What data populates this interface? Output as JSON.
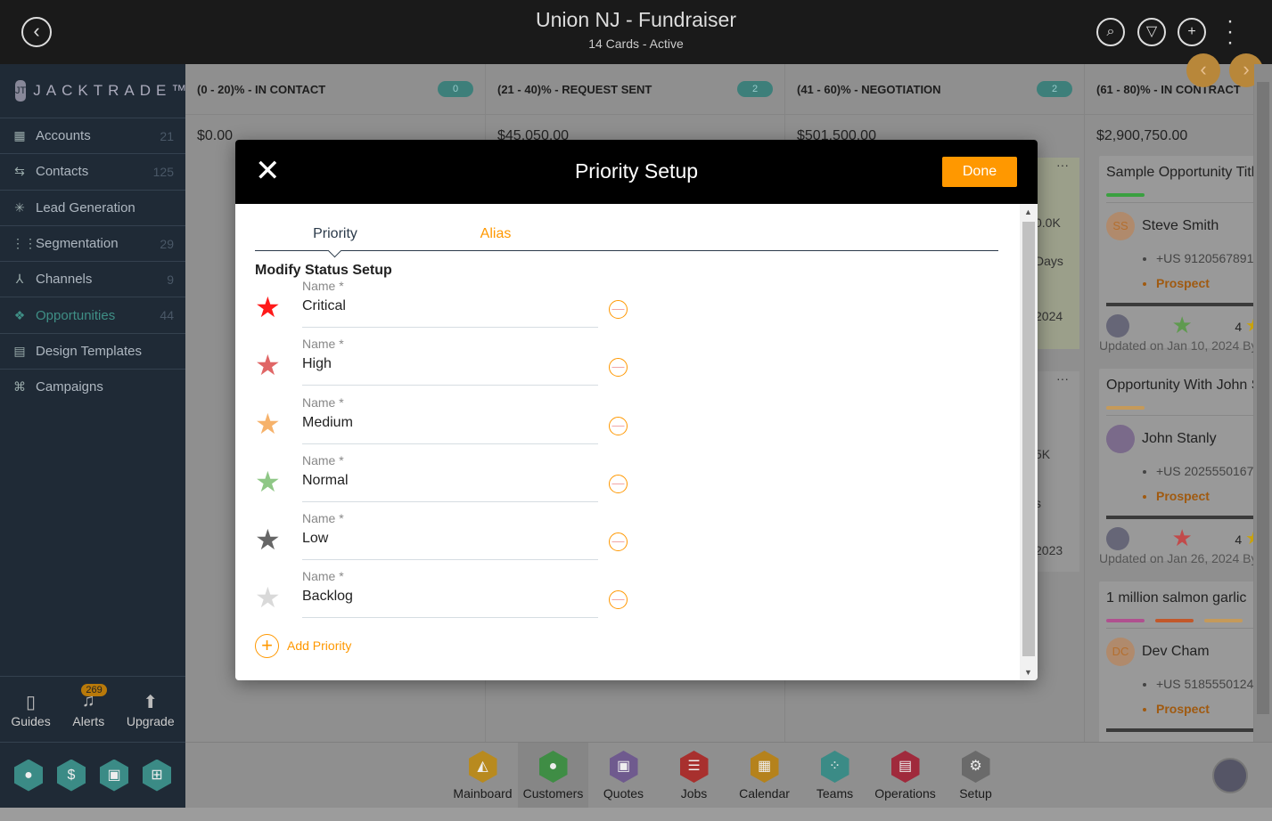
{
  "header": {
    "title": "Union NJ - Fundraiser",
    "subtitle": "14 Cards - Active"
  },
  "sidebar": {
    "logo": "JACKTRADE™",
    "items": [
      {
        "label": "Accounts",
        "count": "21",
        "icon": "building-icon"
      },
      {
        "label": "Contacts",
        "count": "125",
        "icon": "contacts-icon"
      },
      {
        "label": "Lead Generation",
        "count": "",
        "icon": "lead-icon"
      },
      {
        "label": "Segmentation",
        "count": "29",
        "icon": "segmentation-icon"
      },
      {
        "label": "Channels",
        "count": "9",
        "icon": "channels-icon"
      },
      {
        "label": "Opportunities",
        "count": "44",
        "icon": "opportunities-icon",
        "active": true
      },
      {
        "label": "Design Templates",
        "count": "",
        "icon": "templates-icon"
      },
      {
        "label": "Campaigns",
        "count": "",
        "icon": "campaigns-icon"
      }
    ],
    "bottom": {
      "guides": "Guides",
      "alerts": "Alerts",
      "alerts_count": "269",
      "upgrade": "Upgrade"
    }
  },
  "board": {
    "columns": [
      {
        "title": "(0 - 20)% - IN CONTACT",
        "count": "0",
        "amount": "$0.00"
      },
      {
        "title": "(21 - 40)% - REQUEST SENT",
        "count": "2",
        "amount": "$45,050.00"
      },
      {
        "title": "(41 - 60)% - NEGOTIATION",
        "count": "2",
        "amount": "$501,500.00"
      },
      {
        "title": "(61 - 80)% - IN CONTRACT",
        "count": "",
        "amount": "$2,900,750.00"
      }
    ],
    "partial": {
      "a1": "0.0K",
      "a2": "Days",
      "a3": "2024",
      "b1": "5K",
      "b2": "s",
      "b3": "2023"
    },
    "cards": [
      {
        "title": "Sample Opportunity Title",
        "initials": "SS",
        "name": "Steve Smith",
        "phone": "+US 9120567891",
        "status": "Prospect",
        "rating": "4",
        "updated": "Updated on Jan 10, 2024 By"
      },
      {
        "title": "Opportunity With John S",
        "initials": "",
        "name": "John Stanly",
        "phone": "+US 2025550167",
        "status": "Prospect",
        "rating": "4",
        "updated": "Updated on Jan 26, 2024 By"
      },
      {
        "title": "1 million salmon garlic",
        "initials": "DC",
        "name": "Dev Cham",
        "phone": "+US 5185550124",
        "status": "Prospect"
      }
    ]
  },
  "apps": [
    "Mainboard",
    "Customers",
    "Quotes",
    "Jobs",
    "Calendar",
    "Teams",
    "Operations",
    "Setup"
  ],
  "app_colors": [
    "#b88a1f",
    "#3f8d45",
    "#6f5a8e",
    "#a8302e",
    "#b5821c",
    "#3b8b86",
    "#a02a3c",
    "#6a6a6a"
  ],
  "modal": {
    "title": "Priority Setup",
    "done": "Done",
    "tabs": [
      "Priority",
      "Alias"
    ],
    "section": "Modify Status Setup",
    "field_label": "Name *",
    "priorities": [
      {
        "name": "Critical",
        "color": "#ff1a1a"
      },
      {
        "name": "High",
        "color": "#e06666"
      },
      {
        "name": "Medium",
        "color": "#f6b26b"
      },
      {
        "name": "Normal",
        "color": "#8fc786"
      },
      {
        "name": "Low",
        "color": "#666666"
      },
      {
        "name": "Backlog",
        "color": "#d9d9d9"
      }
    ],
    "add": "Add Priority"
  }
}
